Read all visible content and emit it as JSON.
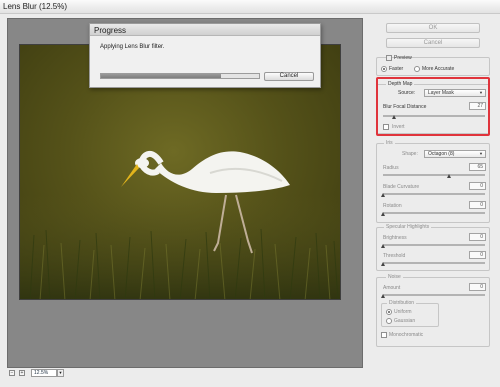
{
  "window": {
    "title": "Lens Blur (12.5%)"
  },
  "progress_dialog": {
    "title": "Progress",
    "message": "Applying Lens Blur filter.",
    "progress_percent": 76,
    "cancel_label": "Cancel"
  },
  "bottom_bar": {
    "zoom": "12.5%"
  },
  "panel": {
    "ok_label": "OK",
    "cancel_label": "Cancel",
    "preview": {
      "label": "Preview",
      "checked": false
    },
    "speed_options": [
      {
        "label": "Faster",
        "selected": true
      },
      {
        "label": "More Accurate",
        "selected": false
      }
    ],
    "depth_map": {
      "title": "Depth Map",
      "source_label": "Source:",
      "source_value": "Layer Mask",
      "blur_focal_distance_label": "Blur Focal Distance",
      "blur_focal_distance_value": "27",
      "invert_label": "Invert"
    },
    "iris": {
      "title": "Iris",
      "shape_label": "Shape:",
      "shape_value": "Octagon (8)",
      "radius_label": "Radius",
      "radius_value": "65",
      "blade_curvature_label": "Blade Curvature",
      "blade_curvature_value": "0",
      "rotation_label": "Rotation",
      "rotation_value": "0"
    },
    "specular": {
      "title": "Specular Highlights",
      "brightness_label": "Brightness",
      "brightness_value": "0",
      "threshold_label": "Threshold",
      "threshold_value": "0"
    },
    "noise": {
      "title": "Noise",
      "amount_label": "Amount",
      "amount_value": "0",
      "distribution_title": "Distribution",
      "distribution_options": [
        {
          "label": "Uniform",
          "selected": true
        },
        {
          "label": "Gaussian",
          "selected": false
        }
      ],
      "monochromatic_label": "Monochromatic"
    }
  },
  "colors": {
    "highlight": "#e0343c",
    "photo_grass": "#555219",
    "egret": "#f4f4f0",
    "beak": "#e2b41c"
  }
}
